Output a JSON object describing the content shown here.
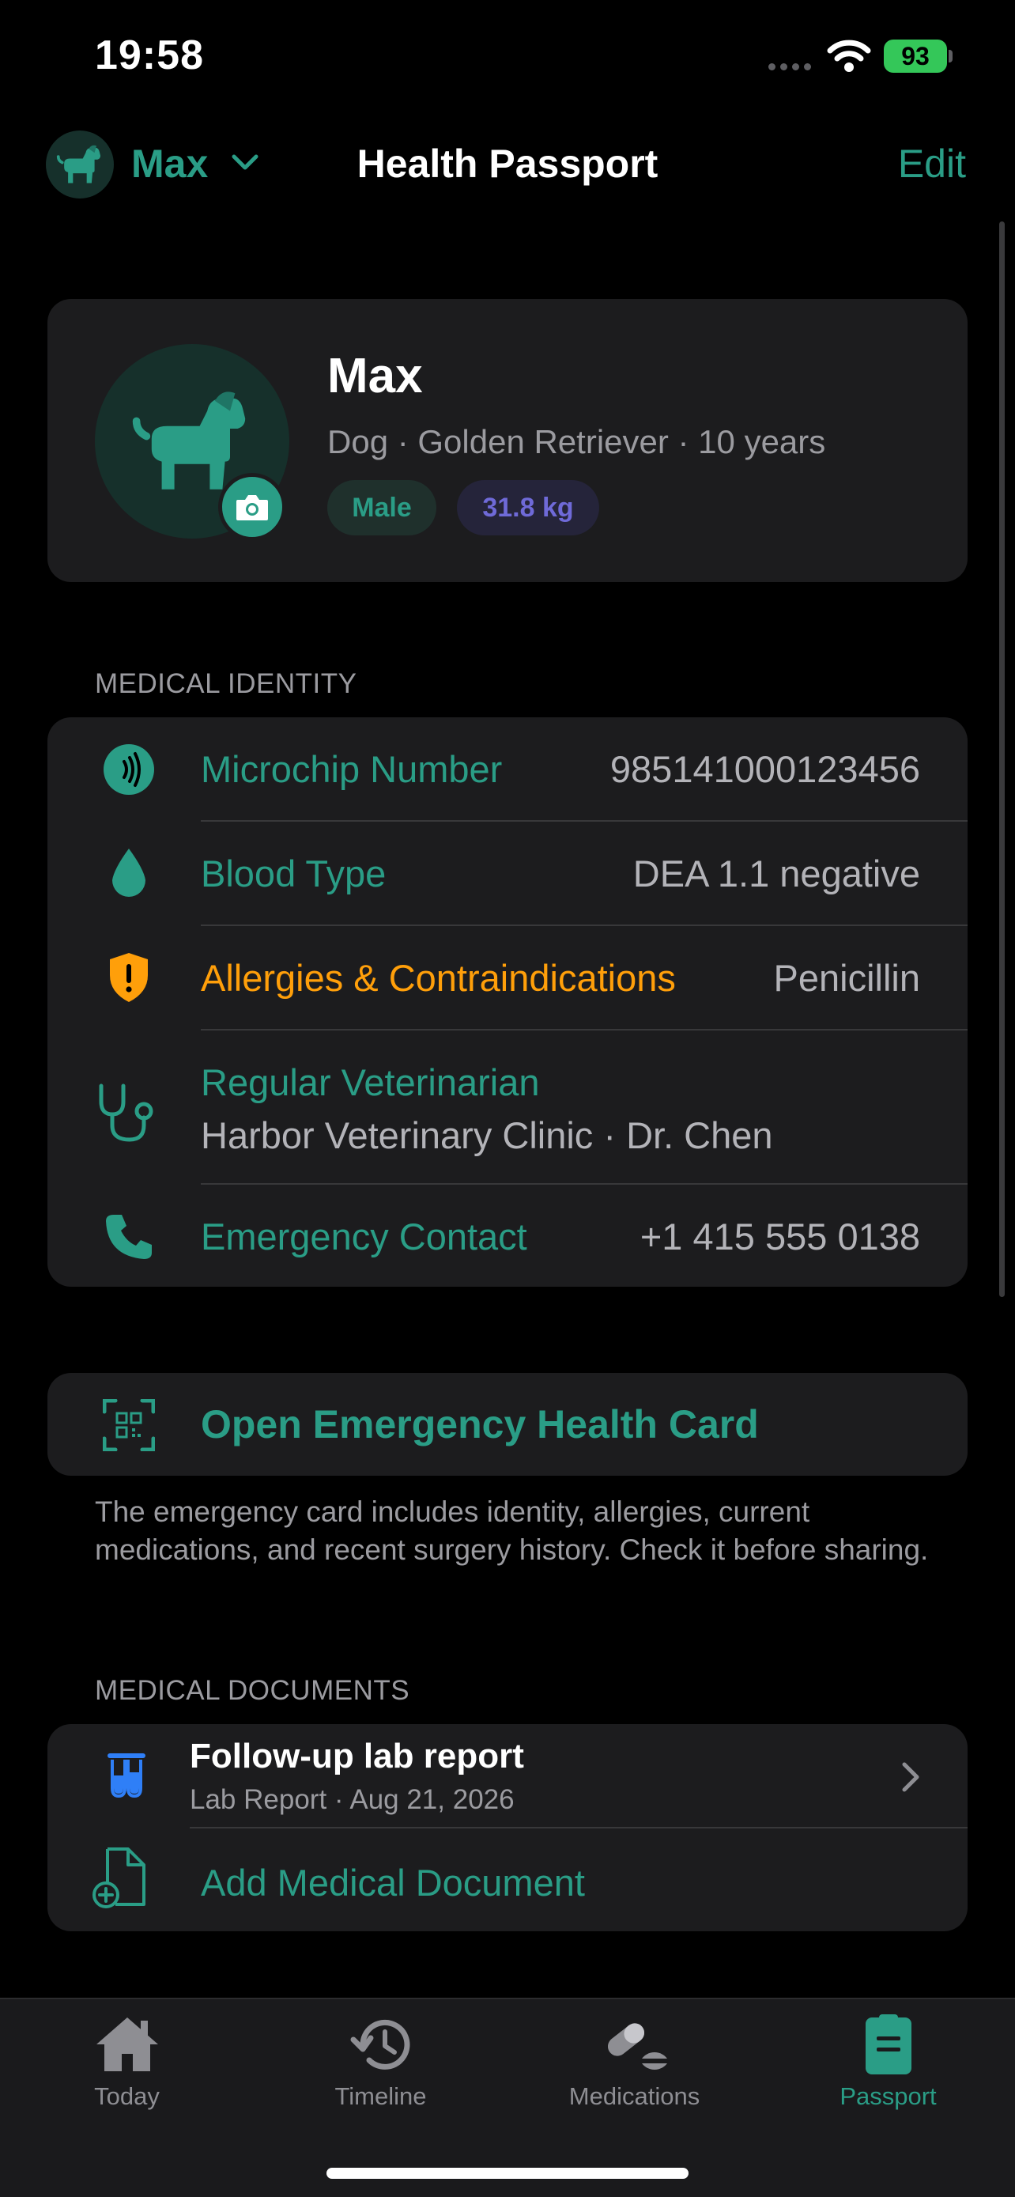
{
  "status_bar": {
    "time": "19:58",
    "battery": "93"
  },
  "nav": {
    "pet_name": "Max",
    "title": "Health Passport",
    "edit_label": "Edit"
  },
  "profile": {
    "name": "Max",
    "description": "Dog · Golden Retriever · 10 years",
    "sex": "Male",
    "weight": "31.8 kg"
  },
  "medical_identity": {
    "header": "MEDICAL IDENTITY",
    "microchip": {
      "label": "Microchip Number",
      "value": "985141000123456"
    },
    "blood_type": {
      "label": "Blood Type",
      "value": "DEA 1.1 negative"
    },
    "allergies": {
      "label": "Allergies & Contraindications",
      "value": "Penicillin"
    },
    "veterinarian": {
      "label": "Regular Veterinarian",
      "value": "Harbor Veterinary Clinic · Dr. Chen"
    },
    "emergency_contact": {
      "label": "Emergency Contact",
      "value": "+1 415 555 0138"
    }
  },
  "emergency_card": {
    "label": "Open Emergency Health Card",
    "note": "The emergency card includes identity, allergies, current medications, and recent surgery history. Check it before sharing."
  },
  "documents": {
    "header": "MEDICAL DOCUMENTS",
    "items": [
      {
        "title": "Follow-up lab report",
        "subtitle": "Lab Report · Aug 21, 2026"
      }
    ],
    "add_label": "Add Medical Document"
  },
  "tabs": [
    {
      "label": "Today",
      "icon": "house-icon"
    },
    {
      "label": "Timeline",
      "icon": "history-icon"
    },
    {
      "label": "Medications",
      "icon": "pills-icon"
    },
    {
      "label": "Passport",
      "icon": "passport-icon"
    }
  ],
  "colors": {
    "accent": "#2a9d86",
    "warning": "#ff9f0a",
    "card": "#1c1c1e",
    "background": "#000000",
    "weight_badge": "#6f6ad8",
    "lab_icon": "#2f7ff7"
  }
}
